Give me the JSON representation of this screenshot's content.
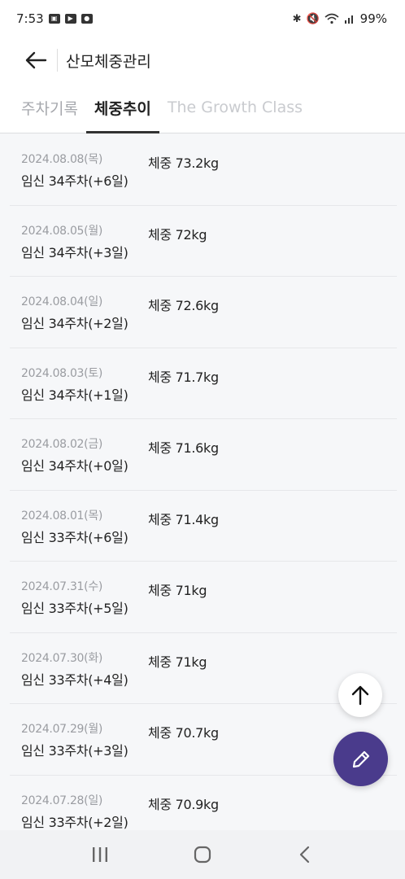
{
  "status_bar": {
    "time": "7:53",
    "battery": "99%",
    "left_icons": [
      "gallery-icon",
      "youtube-icon",
      "talk-icon"
    ],
    "right_icons": [
      "bluetooth-icon",
      "mute-icon",
      "wifi-icon",
      "signal-icon"
    ]
  },
  "header": {
    "title": "산모체중관리"
  },
  "tabs": [
    {
      "label": "주차기록",
      "active": false
    },
    {
      "label": "체중추이",
      "active": true
    },
    {
      "label": "The Growth Class",
      "active": false
    }
  ],
  "records": [
    {
      "date": "2024.08.08(목)",
      "week": "임신 34주차(+6일)",
      "weight": "체중 73.2kg"
    },
    {
      "date": "2024.08.05(월)",
      "week": "임신 34주차(+3일)",
      "weight": "체중 72kg"
    },
    {
      "date": "2024.08.04(일)",
      "week": "임신 34주차(+2일)",
      "weight": "체중 72.6kg"
    },
    {
      "date": "2024.08.03(토)",
      "week": "임신 34주차(+1일)",
      "weight": "체중 71.7kg"
    },
    {
      "date": "2024.08.02(금)",
      "week": "임신 34주차(+0일)",
      "weight": "체중 71.6kg"
    },
    {
      "date": "2024.08.01(목)",
      "week": "임신 33주차(+6일)",
      "weight": "체중 71.4kg"
    },
    {
      "date": "2024.07.31(수)",
      "week": "임신 33주차(+5일)",
      "weight": "체중 71kg"
    },
    {
      "date": "2024.07.30(화)",
      "week": "임신 33주차(+4일)",
      "weight": "체중 71kg"
    },
    {
      "date": "2024.07.29(월)",
      "week": "임신 33주차(+3일)",
      "weight": "체중 70.7kg"
    },
    {
      "date": "2024.07.28(일)",
      "week": "임신 33주차(+2일)",
      "weight": "체중 70.9kg"
    }
  ],
  "colors": {
    "accent": "#4a3b8c",
    "background": "#f6f7f9"
  }
}
